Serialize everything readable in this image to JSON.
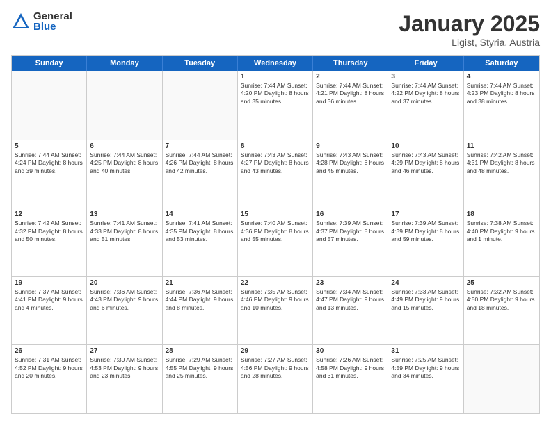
{
  "logo": {
    "general": "General",
    "blue": "Blue"
  },
  "title": {
    "month": "January 2025",
    "location": "Ligist, Styria, Austria"
  },
  "header_days": [
    "Sunday",
    "Monday",
    "Tuesday",
    "Wednesday",
    "Thursday",
    "Friday",
    "Saturday"
  ],
  "weeks": [
    [
      {
        "day": "",
        "content": ""
      },
      {
        "day": "",
        "content": ""
      },
      {
        "day": "",
        "content": ""
      },
      {
        "day": "1",
        "content": "Sunrise: 7:44 AM\nSunset: 4:20 PM\nDaylight: 8 hours\nand 35 minutes."
      },
      {
        "day": "2",
        "content": "Sunrise: 7:44 AM\nSunset: 4:21 PM\nDaylight: 8 hours\nand 36 minutes."
      },
      {
        "day": "3",
        "content": "Sunrise: 7:44 AM\nSunset: 4:22 PM\nDaylight: 8 hours\nand 37 minutes."
      },
      {
        "day": "4",
        "content": "Sunrise: 7:44 AM\nSunset: 4:23 PM\nDaylight: 8 hours\nand 38 minutes."
      }
    ],
    [
      {
        "day": "5",
        "content": "Sunrise: 7:44 AM\nSunset: 4:24 PM\nDaylight: 8 hours\nand 39 minutes."
      },
      {
        "day": "6",
        "content": "Sunrise: 7:44 AM\nSunset: 4:25 PM\nDaylight: 8 hours\nand 40 minutes."
      },
      {
        "day": "7",
        "content": "Sunrise: 7:44 AM\nSunset: 4:26 PM\nDaylight: 8 hours\nand 42 minutes."
      },
      {
        "day": "8",
        "content": "Sunrise: 7:43 AM\nSunset: 4:27 PM\nDaylight: 8 hours\nand 43 minutes."
      },
      {
        "day": "9",
        "content": "Sunrise: 7:43 AM\nSunset: 4:28 PM\nDaylight: 8 hours\nand 45 minutes."
      },
      {
        "day": "10",
        "content": "Sunrise: 7:43 AM\nSunset: 4:29 PM\nDaylight: 8 hours\nand 46 minutes."
      },
      {
        "day": "11",
        "content": "Sunrise: 7:42 AM\nSunset: 4:31 PM\nDaylight: 8 hours\nand 48 minutes."
      }
    ],
    [
      {
        "day": "12",
        "content": "Sunrise: 7:42 AM\nSunset: 4:32 PM\nDaylight: 8 hours\nand 50 minutes."
      },
      {
        "day": "13",
        "content": "Sunrise: 7:41 AM\nSunset: 4:33 PM\nDaylight: 8 hours\nand 51 minutes."
      },
      {
        "day": "14",
        "content": "Sunrise: 7:41 AM\nSunset: 4:35 PM\nDaylight: 8 hours\nand 53 minutes."
      },
      {
        "day": "15",
        "content": "Sunrise: 7:40 AM\nSunset: 4:36 PM\nDaylight: 8 hours\nand 55 minutes."
      },
      {
        "day": "16",
        "content": "Sunrise: 7:39 AM\nSunset: 4:37 PM\nDaylight: 8 hours\nand 57 minutes."
      },
      {
        "day": "17",
        "content": "Sunrise: 7:39 AM\nSunset: 4:39 PM\nDaylight: 8 hours\nand 59 minutes."
      },
      {
        "day": "18",
        "content": "Sunrise: 7:38 AM\nSunset: 4:40 PM\nDaylight: 9 hours\nand 1 minute."
      }
    ],
    [
      {
        "day": "19",
        "content": "Sunrise: 7:37 AM\nSunset: 4:41 PM\nDaylight: 9 hours\nand 4 minutes."
      },
      {
        "day": "20",
        "content": "Sunrise: 7:36 AM\nSunset: 4:43 PM\nDaylight: 9 hours\nand 6 minutes."
      },
      {
        "day": "21",
        "content": "Sunrise: 7:36 AM\nSunset: 4:44 PM\nDaylight: 9 hours\nand 8 minutes."
      },
      {
        "day": "22",
        "content": "Sunrise: 7:35 AM\nSunset: 4:46 PM\nDaylight: 9 hours\nand 10 minutes."
      },
      {
        "day": "23",
        "content": "Sunrise: 7:34 AM\nSunset: 4:47 PM\nDaylight: 9 hours\nand 13 minutes."
      },
      {
        "day": "24",
        "content": "Sunrise: 7:33 AM\nSunset: 4:49 PM\nDaylight: 9 hours\nand 15 minutes."
      },
      {
        "day": "25",
        "content": "Sunrise: 7:32 AM\nSunset: 4:50 PM\nDaylight: 9 hours\nand 18 minutes."
      }
    ],
    [
      {
        "day": "26",
        "content": "Sunrise: 7:31 AM\nSunset: 4:52 PM\nDaylight: 9 hours\nand 20 minutes."
      },
      {
        "day": "27",
        "content": "Sunrise: 7:30 AM\nSunset: 4:53 PM\nDaylight: 9 hours\nand 23 minutes."
      },
      {
        "day": "28",
        "content": "Sunrise: 7:29 AM\nSunset: 4:55 PM\nDaylight: 9 hours\nand 25 minutes."
      },
      {
        "day": "29",
        "content": "Sunrise: 7:27 AM\nSunset: 4:56 PM\nDaylight: 9 hours\nand 28 minutes."
      },
      {
        "day": "30",
        "content": "Sunrise: 7:26 AM\nSunset: 4:58 PM\nDaylight: 9 hours\nand 31 minutes."
      },
      {
        "day": "31",
        "content": "Sunrise: 7:25 AM\nSunset: 4:59 PM\nDaylight: 9 hours\nand 34 minutes."
      },
      {
        "day": "",
        "content": ""
      }
    ]
  ]
}
